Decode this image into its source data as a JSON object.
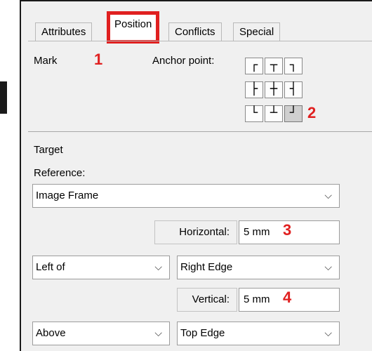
{
  "tabs": [
    "Attributes",
    "Position",
    "Conflicts",
    "Special"
  ],
  "mark_label": "Mark",
  "anchor_label": "Anchor point:",
  "anchor_glyphs": [
    "┌",
    "┬",
    "┐",
    "├",
    "┼",
    "┤",
    "└",
    "┴",
    "┘"
  ],
  "anchor_selected": "bottom-right",
  "callouts": [
    "1",
    "2",
    "3",
    "4"
  ],
  "target_label": "Target",
  "reference_label": "Reference:",
  "reference_value": "Image Frame",
  "horizontal_label": "Horizontal:",
  "horizontal_value": "5 mm",
  "h_relation": "Left of",
  "h_edge": "Right Edge",
  "vertical_label": "Vertical:",
  "vertical_value": "5 mm",
  "v_relation": "Above",
  "v_edge": "Top Edge",
  "dropdown_glyph": "⌵",
  "colors": {
    "highlight": "#e02020",
    "panel": "#f0f0f0"
  }
}
